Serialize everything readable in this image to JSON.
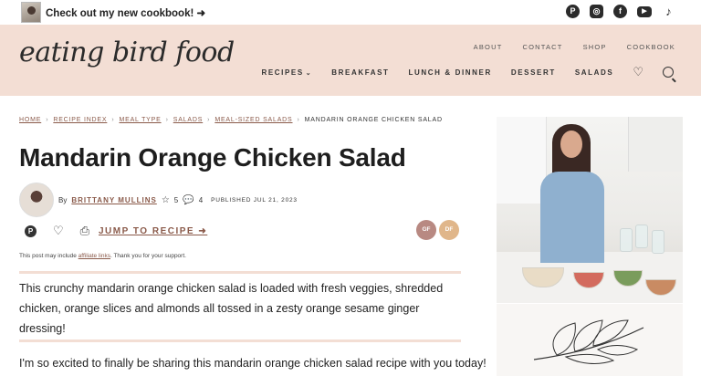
{
  "topbar": {
    "promo": "Check out my new cookbook! ➜",
    "social": [
      {
        "icon": "pinterest-icon",
        "glyph": "P"
      },
      {
        "icon": "instagram-icon",
        "glyph": "◎"
      },
      {
        "icon": "facebook-icon",
        "glyph": "f"
      },
      {
        "icon": "youtube-icon",
        "glyph": "▶"
      },
      {
        "icon": "tiktok-icon",
        "glyph": "♪"
      }
    ]
  },
  "header": {
    "logo": "eating bird food",
    "util_nav": [
      "ABOUT",
      "CONTACT",
      "SHOP",
      "COOKBOOK"
    ],
    "main_nav": [
      "RECIPES",
      "BREAKFAST",
      "LUNCH & DINNER",
      "DESSERT",
      "SALADS"
    ],
    "colors": {
      "header_bg": "#f3ded4",
      "accent": "#8a5a4a"
    }
  },
  "breadcrumb": {
    "links": [
      "HOME",
      "RECIPE INDEX",
      "MEAL TYPE",
      "SALADS",
      "MEAL-SIZED SALADS"
    ],
    "current": "MANDARIN ORANGE CHICKEN SALAD"
  },
  "post": {
    "title": "Mandarin Orange Chicken Salad",
    "by": "By",
    "author": "BRITTANY MULLINS",
    "rating_count": "5",
    "comment_count": "4",
    "published": "PUBLISHED JUL 21, 2023",
    "jump": "JUMP TO RECIPE ➜",
    "badges": {
      "gf": "GF",
      "df": "DF"
    },
    "affiliate_before": "This post may include ",
    "affiliate_link": "affiliate links",
    "affiliate_after": ". Thank you for your support.",
    "intro": "This crunchy mandarin orange chicken salad is loaded with fresh veggies, shredded chicken, orange slices and almonds all tossed in a zesty orange sesame ginger dressing!",
    "para2": "I'm so excited to finally be sharing this mandarin orange chicken salad recipe with you today!"
  }
}
